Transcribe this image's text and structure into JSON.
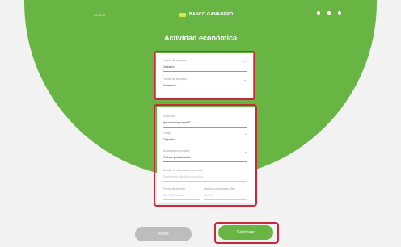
{
  "header": {
    "nav_left_label": "INICIO",
    "brand_name": "BANCO GANADERO",
    "icons": [
      "user-icon",
      "menu-icon",
      "info-icon"
    ]
  },
  "page": {
    "title": "Actividad económica"
  },
  "section1": {
    "f1": {
      "label": "Estado de ingresos",
      "value": "Ordinario"
    },
    "f2": {
      "label": "Fuente de ingresos",
      "value": "Asalariado"
    }
  },
  "section2": {
    "employer": {
      "label": "Empresa",
      "value": "Ipsum Incorporated S.A."
    },
    "position": {
      "label": "Cargo",
      "value": "Operador"
    },
    "activity": {
      "label": "Actividad económica",
      "value": "Trabajo y asalariados"
    },
    "specific": {
      "label": "Detalle de actividad económica",
      "placeholder": "Describe tu actividad específica"
    },
    "start_date": {
      "label": "Fecha de ingreso",
      "placeholder": "DD / MM / AAAA"
    },
    "income": {
      "label": "Ingresos mensuales (Bs)",
      "placeholder": "Bs 0,00"
    }
  },
  "buttons": {
    "back": "Volver",
    "next": "Continuar"
  },
  "colors": {
    "brand_green": "#69b544",
    "highlight_red": "#c8283a",
    "background": "#f2f2f2"
  }
}
